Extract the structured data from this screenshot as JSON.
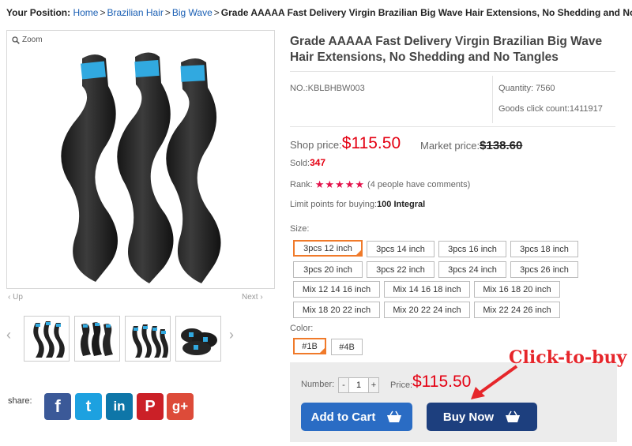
{
  "breadcrumb": {
    "prefix": "Your Position:",
    "links": [
      "Home",
      "Brazilian Hair",
      "Big Wave"
    ],
    "current": "Grade AAAAA Fast Delivery Virgin Brazilian Big Wave Hair Extensions, No Shedding and No",
    "separator": ">"
  },
  "gallery": {
    "zoom_label": "Zoom",
    "up_label": "Up",
    "next_label": "Next",
    "thumb_count": 4
  },
  "share": {
    "label": "share:",
    "networks": [
      {
        "name": "facebook",
        "glyph": "f",
        "color": "#3b5998"
      },
      {
        "name": "twitter",
        "glyph": "t",
        "color": "#1da1e0"
      },
      {
        "name": "linkedin",
        "glyph": "in",
        "color": "#0e76a8"
      },
      {
        "name": "pinterest",
        "glyph": "P",
        "color": "#cb2027"
      },
      {
        "name": "google-plus",
        "glyph": "g+",
        "color": "#dd4b39"
      }
    ]
  },
  "product": {
    "title": "Grade AAAAA Fast Delivery Virgin Brazilian Big Wave Hair Extensions, No Shedding and No Tangles",
    "sku": "NO.:KBLBHBW003",
    "quantity": "Quantity: 7560",
    "clicks": "Goods click count:1411917",
    "shop_price_label": "Shop price:",
    "shop_price": "$115.50",
    "market_price_label": "Market price:",
    "market_price": "$138.60",
    "sold_label": "Sold:",
    "sold": "347",
    "rank_label": "Rank:",
    "rank_stars": 5,
    "rank_comments": "(4 people have comments)",
    "limit_label": "Limit points for buying:",
    "limit_value": "100 Integral"
  },
  "size": {
    "label": "Size:",
    "selected": "3pcs 12 inch",
    "options": [
      "3pcs 12 inch",
      "3pcs 14 inch",
      "3pcs 16 inch",
      "3pcs 18 inch",
      "3pcs 20 inch",
      "3pcs 22 inch",
      "3pcs 24 inch",
      "3pcs 26 inch",
      "Mix 12 14 16 inch",
      "Mix 14 16 18 inch",
      "Mix 16 18 20 inch",
      "Mix 18 20 22 inch",
      "Mix 20 22 24 inch",
      "Mix 22 24 26 inch"
    ]
  },
  "color": {
    "label": "Color:",
    "selected": "#1B",
    "options": [
      "#1B",
      "#4B"
    ]
  },
  "purchase": {
    "number_label": "Number:",
    "minus": "-",
    "quantity": "1",
    "plus": "+",
    "price_label": "Price:",
    "price": "$115.50",
    "add_to_cart": "Add to Cart",
    "buy_now": "Buy Now"
  },
  "annotation": {
    "text": "Click-to-buy",
    "color": "#e6262b"
  }
}
